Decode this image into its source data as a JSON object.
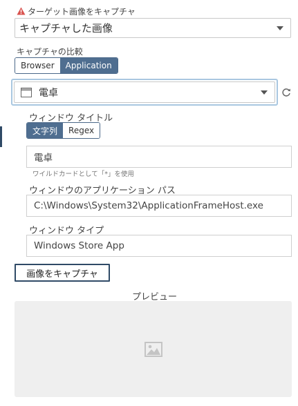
{
  "target": {
    "label": "ターゲット画像をキャプチャ",
    "selected": "キャプチャした画像"
  },
  "compare": {
    "label": "キャプチャの比較",
    "options": [
      "Browser",
      "Application"
    ],
    "selected": "Application"
  },
  "app_select": {
    "selected": "電卓"
  },
  "window_title": {
    "label": "ウィンドウ タイトル",
    "modes": [
      "文字列",
      "Regex"
    ],
    "selected_mode": "文字列",
    "value": "電卓",
    "hint": "ワイルドカードとして「*」を使用"
  },
  "app_path": {
    "label": "ウィンドウのアプリケーション パス",
    "value": "C:\\Windows\\System32\\ApplicationFrameHost.exe"
  },
  "window_type": {
    "label": "ウィンドウ タイプ",
    "value": "Windows Store App"
  },
  "capture_button": {
    "label": "画像をキャプチャ"
  },
  "preview": {
    "label": "プレビュー"
  },
  "colors": {
    "accent": "#4f6e90",
    "warning": "#d9534f",
    "focus_border": "#a9c7e0"
  },
  "icons": {
    "warning": "warning-icon",
    "window": "window-icon",
    "refresh": "refresh-icon",
    "image_placeholder": "image-placeholder-icon"
  }
}
